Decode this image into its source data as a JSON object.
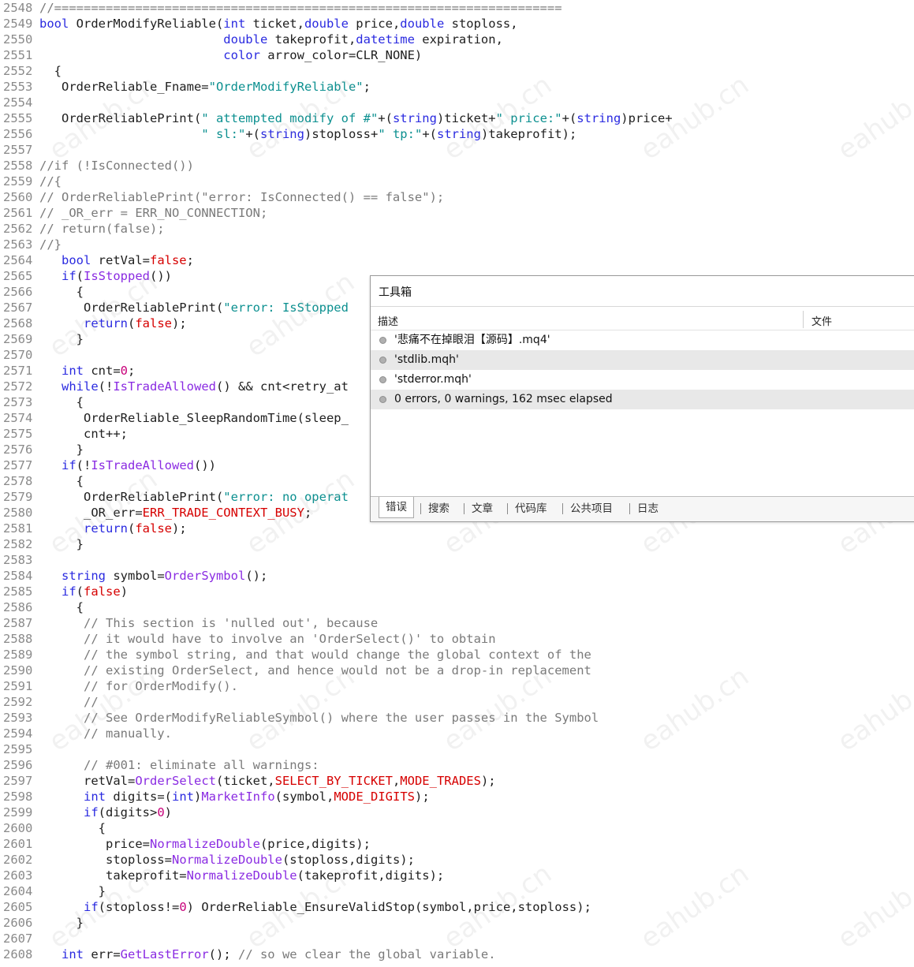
{
  "editor": {
    "lines": [
      {
        "n": "2548",
        "t": [
          {
            "c": "cm",
            "v": "//====================================================================="
          }
        ]
      },
      {
        "n": "2549",
        "t": [
          {
            "c": "kw",
            "v": "bool"
          },
          {
            "c": "pl",
            "v": " OrderModifyReliable("
          },
          {
            "c": "kw",
            "v": "int"
          },
          {
            "c": "pl",
            "v": " ticket,"
          },
          {
            "c": "kw",
            "v": "double"
          },
          {
            "c": "pl",
            "v": " price,"
          },
          {
            "c": "kw",
            "v": "double"
          },
          {
            "c": "pl",
            "v": " stoploss,"
          }
        ]
      },
      {
        "n": "2550",
        "t": [
          {
            "c": "pl",
            "v": "                         "
          },
          {
            "c": "kw",
            "v": "double"
          },
          {
            "c": "pl",
            "v": " takeprofit,"
          },
          {
            "c": "kw",
            "v": "datetime"
          },
          {
            "c": "pl",
            "v": " expiration,"
          }
        ]
      },
      {
        "n": "2551",
        "t": [
          {
            "c": "pl",
            "v": "                         "
          },
          {
            "c": "kw",
            "v": "color"
          },
          {
            "c": "pl",
            "v": " arrow_color=CLR_NONE)"
          }
        ]
      },
      {
        "n": "2552",
        "t": [
          {
            "c": "pl",
            "v": "  {"
          }
        ]
      },
      {
        "n": "2553",
        "t": [
          {
            "c": "pl",
            "v": "   OrderReliable_Fname="
          },
          {
            "c": "str",
            "v": "\"OrderModifyReliable\""
          },
          {
            "c": "pl",
            "v": ";"
          }
        ]
      },
      {
        "n": "2554",
        "t": []
      },
      {
        "n": "2555",
        "t": [
          {
            "c": "pl",
            "v": "   OrderReliablePrint("
          },
          {
            "c": "str",
            "v": "\" attempted modify of #\""
          },
          {
            "c": "pl",
            "v": "+("
          },
          {
            "c": "kw",
            "v": "string"
          },
          {
            "c": "pl",
            "v": ")ticket+"
          },
          {
            "c": "str",
            "v": "\" price:\""
          },
          {
            "c": "pl",
            "v": "+("
          },
          {
            "c": "kw",
            "v": "string"
          },
          {
            "c": "pl",
            "v": ")price+"
          }
        ]
      },
      {
        "n": "2556",
        "t": [
          {
            "c": "pl",
            "v": "                      "
          },
          {
            "c": "str",
            "v": "\" sl:\""
          },
          {
            "c": "pl",
            "v": "+("
          },
          {
            "c": "kw",
            "v": "string"
          },
          {
            "c": "pl",
            "v": ")stoploss+"
          },
          {
            "c": "str",
            "v": "\" tp:\""
          },
          {
            "c": "pl",
            "v": "+("
          },
          {
            "c": "kw",
            "v": "string"
          },
          {
            "c": "pl",
            "v": ")takeprofit);"
          }
        ]
      },
      {
        "n": "2557",
        "t": []
      },
      {
        "n": "2558",
        "t": [
          {
            "c": "cm",
            "v": "//if (!IsConnected())"
          }
        ]
      },
      {
        "n": "2559",
        "t": [
          {
            "c": "cm",
            "v": "//{"
          }
        ]
      },
      {
        "n": "2560",
        "t": [
          {
            "c": "cm",
            "v": "// OrderReliablePrint(\"error: IsConnected() == false\");"
          }
        ]
      },
      {
        "n": "2561",
        "t": [
          {
            "c": "cm",
            "v": "// _OR_err = ERR_NO_CONNECTION;"
          }
        ]
      },
      {
        "n": "2562",
        "t": [
          {
            "c": "cm",
            "v": "// return(false);"
          }
        ]
      },
      {
        "n": "2563",
        "t": [
          {
            "c": "cm",
            "v": "//}"
          }
        ]
      },
      {
        "n": "2564",
        "t": [
          {
            "c": "pl",
            "v": "   "
          },
          {
            "c": "kw",
            "v": "bool"
          },
          {
            "c": "pl",
            "v": " retVal="
          },
          {
            "c": "const",
            "v": "false"
          },
          {
            "c": "pl",
            "v": ";"
          }
        ]
      },
      {
        "n": "2565",
        "t": [
          {
            "c": "pl",
            "v": "   "
          },
          {
            "c": "kw",
            "v": "if"
          },
          {
            "c": "pl",
            "v": "("
          },
          {
            "c": "fn",
            "v": "IsStopped"
          },
          {
            "c": "pl",
            "v": "())"
          }
        ]
      },
      {
        "n": "2566",
        "t": [
          {
            "c": "pl",
            "v": "     {"
          }
        ]
      },
      {
        "n": "2567",
        "t": [
          {
            "c": "pl",
            "v": "      OrderReliablePrint("
          },
          {
            "c": "str",
            "v": "\"error: IsStopped"
          }
        ]
      },
      {
        "n": "2568",
        "t": [
          {
            "c": "pl",
            "v": "      "
          },
          {
            "c": "kw",
            "v": "return"
          },
          {
            "c": "pl",
            "v": "("
          },
          {
            "c": "const",
            "v": "false"
          },
          {
            "c": "pl",
            "v": ");"
          }
        ]
      },
      {
        "n": "2569",
        "t": [
          {
            "c": "pl",
            "v": "     }"
          }
        ]
      },
      {
        "n": "2570",
        "t": []
      },
      {
        "n": "2571",
        "t": [
          {
            "c": "pl",
            "v": "   "
          },
          {
            "c": "kw",
            "v": "int"
          },
          {
            "c": "pl",
            "v": " cnt="
          },
          {
            "c": "num",
            "v": "0"
          },
          {
            "c": "pl",
            "v": ";"
          }
        ]
      },
      {
        "n": "2572",
        "t": [
          {
            "c": "pl",
            "v": "   "
          },
          {
            "c": "kw",
            "v": "while"
          },
          {
            "c": "pl",
            "v": "(!"
          },
          {
            "c": "fn",
            "v": "IsTradeAllowed"
          },
          {
            "c": "pl",
            "v": "() && cnt<retry_at"
          }
        ]
      },
      {
        "n": "2573",
        "t": [
          {
            "c": "pl",
            "v": "     {"
          }
        ]
      },
      {
        "n": "2574",
        "t": [
          {
            "c": "pl",
            "v": "      OrderReliable_SleepRandomTime(sleep_"
          }
        ]
      },
      {
        "n": "2575",
        "t": [
          {
            "c": "pl",
            "v": "      cnt++;"
          }
        ]
      },
      {
        "n": "2576",
        "t": [
          {
            "c": "pl",
            "v": "     }"
          }
        ]
      },
      {
        "n": "2577",
        "t": [
          {
            "c": "pl",
            "v": "   "
          },
          {
            "c": "kw",
            "v": "if"
          },
          {
            "c": "pl",
            "v": "(!"
          },
          {
            "c": "fn",
            "v": "IsTradeAllowed"
          },
          {
            "c": "pl",
            "v": "())"
          }
        ]
      },
      {
        "n": "2578",
        "t": [
          {
            "c": "pl",
            "v": "     {"
          }
        ]
      },
      {
        "n": "2579",
        "t": [
          {
            "c": "pl",
            "v": "      OrderReliablePrint("
          },
          {
            "c": "str",
            "v": "\"error: no operat"
          }
        ]
      },
      {
        "n": "2580",
        "t": [
          {
            "c": "pl",
            "v": "      _OR_err="
          },
          {
            "c": "const",
            "v": "ERR_TRADE_CONTEXT_BUSY"
          },
          {
            "c": "pl",
            "v": ";"
          }
        ]
      },
      {
        "n": "2581",
        "t": [
          {
            "c": "pl",
            "v": "      "
          },
          {
            "c": "kw",
            "v": "return"
          },
          {
            "c": "pl",
            "v": "("
          },
          {
            "c": "const",
            "v": "false"
          },
          {
            "c": "pl",
            "v": ");"
          }
        ]
      },
      {
        "n": "2582",
        "t": [
          {
            "c": "pl",
            "v": "     }"
          }
        ]
      },
      {
        "n": "2583",
        "t": []
      },
      {
        "n": "2584",
        "t": [
          {
            "c": "pl",
            "v": "   "
          },
          {
            "c": "kw",
            "v": "string"
          },
          {
            "c": "pl",
            "v": " symbol="
          },
          {
            "c": "fn",
            "v": "OrderSymbol"
          },
          {
            "c": "pl",
            "v": "();"
          }
        ]
      },
      {
        "n": "2585",
        "t": [
          {
            "c": "pl",
            "v": "   "
          },
          {
            "c": "kw",
            "v": "if"
          },
          {
            "c": "pl",
            "v": "("
          },
          {
            "c": "const",
            "v": "false"
          },
          {
            "c": "pl",
            "v": ")"
          }
        ]
      },
      {
        "n": "2586",
        "t": [
          {
            "c": "pl",
            "v": "     {"
          }
        ]
      },
      {
        "n": "2587",
        "t": [
          {
            "c": "cm",
            "v": "      // This section is 'nulled out', because"
          }
        ]
      },
      {
        "n": "2588",
        "t": [
          {
            "c": "cm",
            "v": "      // it would have to involve an 'OrderSelect()' to obtain"
          }
        ]
      },
      {
        "n": "2589",
        "t": [
          {
            "c": "cm",
            "v": "      // the symbol string, and that would change the global context of the"
          }
        ]
      },
      {
        "n": "2590",
        "t": [
          {
            "c": "cm",
            "v": "      // existing OrderSelect, and hence would not be a drop-in replacement"
          }
        ]
      },
      {
        "n": "2591",
        "t": [
          {
            "c": "cm",
            "v": "      // for OrderModify()."
          }
        ]
      },
      {
        "n": "2592",
        "t": [
          {
            "c": "cm",
            "v": "      //"
          }
        ]
      },
      {
        "n": "2593",
        "t": [
          {
            "c": "cm",
            "v": "      // See OrderModifyReliableSymbol() where the user passes in the Symbol"
          }
        ]
      },
      {
        "n": "2594",
        "t": [
          {
            "c": "cm",
            "v": "      // manually."
          }
        ]
      },
      {
        "n": "2595",
        "t": []
      },
      {
        "n": "2596",
        "t": [
          {
            "c": "cm",
            "v": "      // #001: eliminate all warnings:"
          }
        ]
      },
      {
        "n": "2597",
        "t": [
          {
            "c": "pl",
            "v": "      retVal="
          },
          {
            "c": "fn",
            "v": "OrderSelect"
          },
          {
            "c": "pl",
            "v": "(ticket,"
          },
          {
            "c": "const",
            "v": "SELECT_BY_TICKET"
          },
          {
            "c": "pl",
            "v": ","
          },
          {
            "c": "const",
            "v": "MODE_TRADES"
          },
          {
            "c": "pl",
            "v": ");"
          }
        ]
      },
      {
        "n": "2598",
        "t": [
          {
            "c": "pl",
            "v": "      "
          },
          {
            "c": "kw",
            "v": "int"
          },
          {
            "c": "pl",
            "v": " digits=("
          },
          {
            "c": "kw",
            "v": "int"
          },
          {
            "c": "pl",
            "v": ")"
          },
          {
            "c": "fn",
            "v": "MarketInfo"
          },
          {
            "c": "pl",
            "v": "(symbol,"
          },
          {
            "c": "const",
            "v": "MODE_DIGITS"
          },
          {
            "c": "pl",
            "v": ");"
          }
        ]
      },
      {
        "n": "2599",
        "t": [
          {
            "c": "pl",
            "v": "      "
          },
          {
            "c": "kw",
            "v": "if"
          },
          {
            "c": "pl",
            "v": "(digits>"
          },
          {
            "c": "num",
            "v": "0"
          },
          {
            "c": "pl",
            "v": ")"
          }
        ]
      },
      {
        "n": "2600",
        "t": [
          {
            "c": "pl",
            "v": "        {"
          }
        ]
      },
      {
        "n": "2601",
        "t": [
          {
            "c": "pl",
            "v": "         price="
          },
          {
            "c": "fn",
            "v": "NormalizeDouble"
          },
          {
            "c": "pl",
            "v": "(price,digits);"
          }
        ]
      },
      {
        "n": "2602",
        "t": [
          {
            "c": "pl",
            "v": "         stoploss="
          },
          {
            "c": "fn",
            "v": "NormalizeDouble"
          },
          {
            "c": "pl",
            "v": "(stoploss,digits);"
          }
        ]
      },
      {
        "n": "2603",
        "t": [
          {
            "c": "pl",
            "v": "         takeprofit="
          },
          {
            "c": "fn",
            "v": "NormalizeDouble"
          },
          {
            "c": "pl",
            "v": "(takeprofit,digits);"
          }
        ]
      },
      {
        "n": "2604",
        "t": [
          {
            "c": "pl",
            "v": "        }"
          }
        ]
      },
      {
        "n": "2605",
        "t": [
          {
            "c": "pl",
            "v": "      "
          },
          {
            "c": "kw",
            "v": "if"
          },
          {
            "c": "pl",
            "v": "(stoploss!="
          },
          {
            "c": "num",
            "v": "0"
          },
          {
            "c": "pl",
            "v": ") OrderReliable_EnsureValidStop(symbol,price,stoploss);"
          }
        ]
      },
      {
        "n": "2606",
        "t": [
          {
            "c": "pl",
            "v": "     }"
          }
        ]
      },
      {
        "n": "2607",
        "t": []
      },
      {
        "n": "2608",
        "t": [
          {
            "c": "pl",
            "v": "   "
          },
          {
            "c": "kw",
            "v": "int"
          },
          {
            "c": "pl",
            "v": " err="
          },
          {
            "c": "fn",
            "v": "GetLastError"
          },
          {
            "c": "pl",
            "v": "(); "
          },
          {
            "c": "cm",
            "v": "// so we clear the global variable."
          }
        ]
      }
    ]
  },
  "watermark": "eahub.cn",
  "toolbox": {
    "title": "工具箱",
    "columns": {
      "description": "描述",
      "file": "文件"
    },
    "rows": [
      {
        "text": "'悲痛不在掉眼泪【源码】.mq4'",
        "shaded": false
      },
      {
        "text": "'stdlib.mqh'",
        "shaded": true
      },
      {
        "text": "'stderror.mqh'",
        "shaded": false
      },
      {
        "text": "0 errors, 0 warnings, 162 msec elapsed",
        "shaded": true
      }
    ],
    "tabs": [
      "错误",
      "搜索",
      "文章",
      "代码库",
      "公共项目",
      "日志"
    ],
    "active_tab": "错误"
  },
  "colors": {
    "keyword": "#2a2ae0",
    "function": "#8a2be2",
    "string": "#0c9090",
    "constant": "#d60000",
    "comment": "#7a7a7a"
  }
}
